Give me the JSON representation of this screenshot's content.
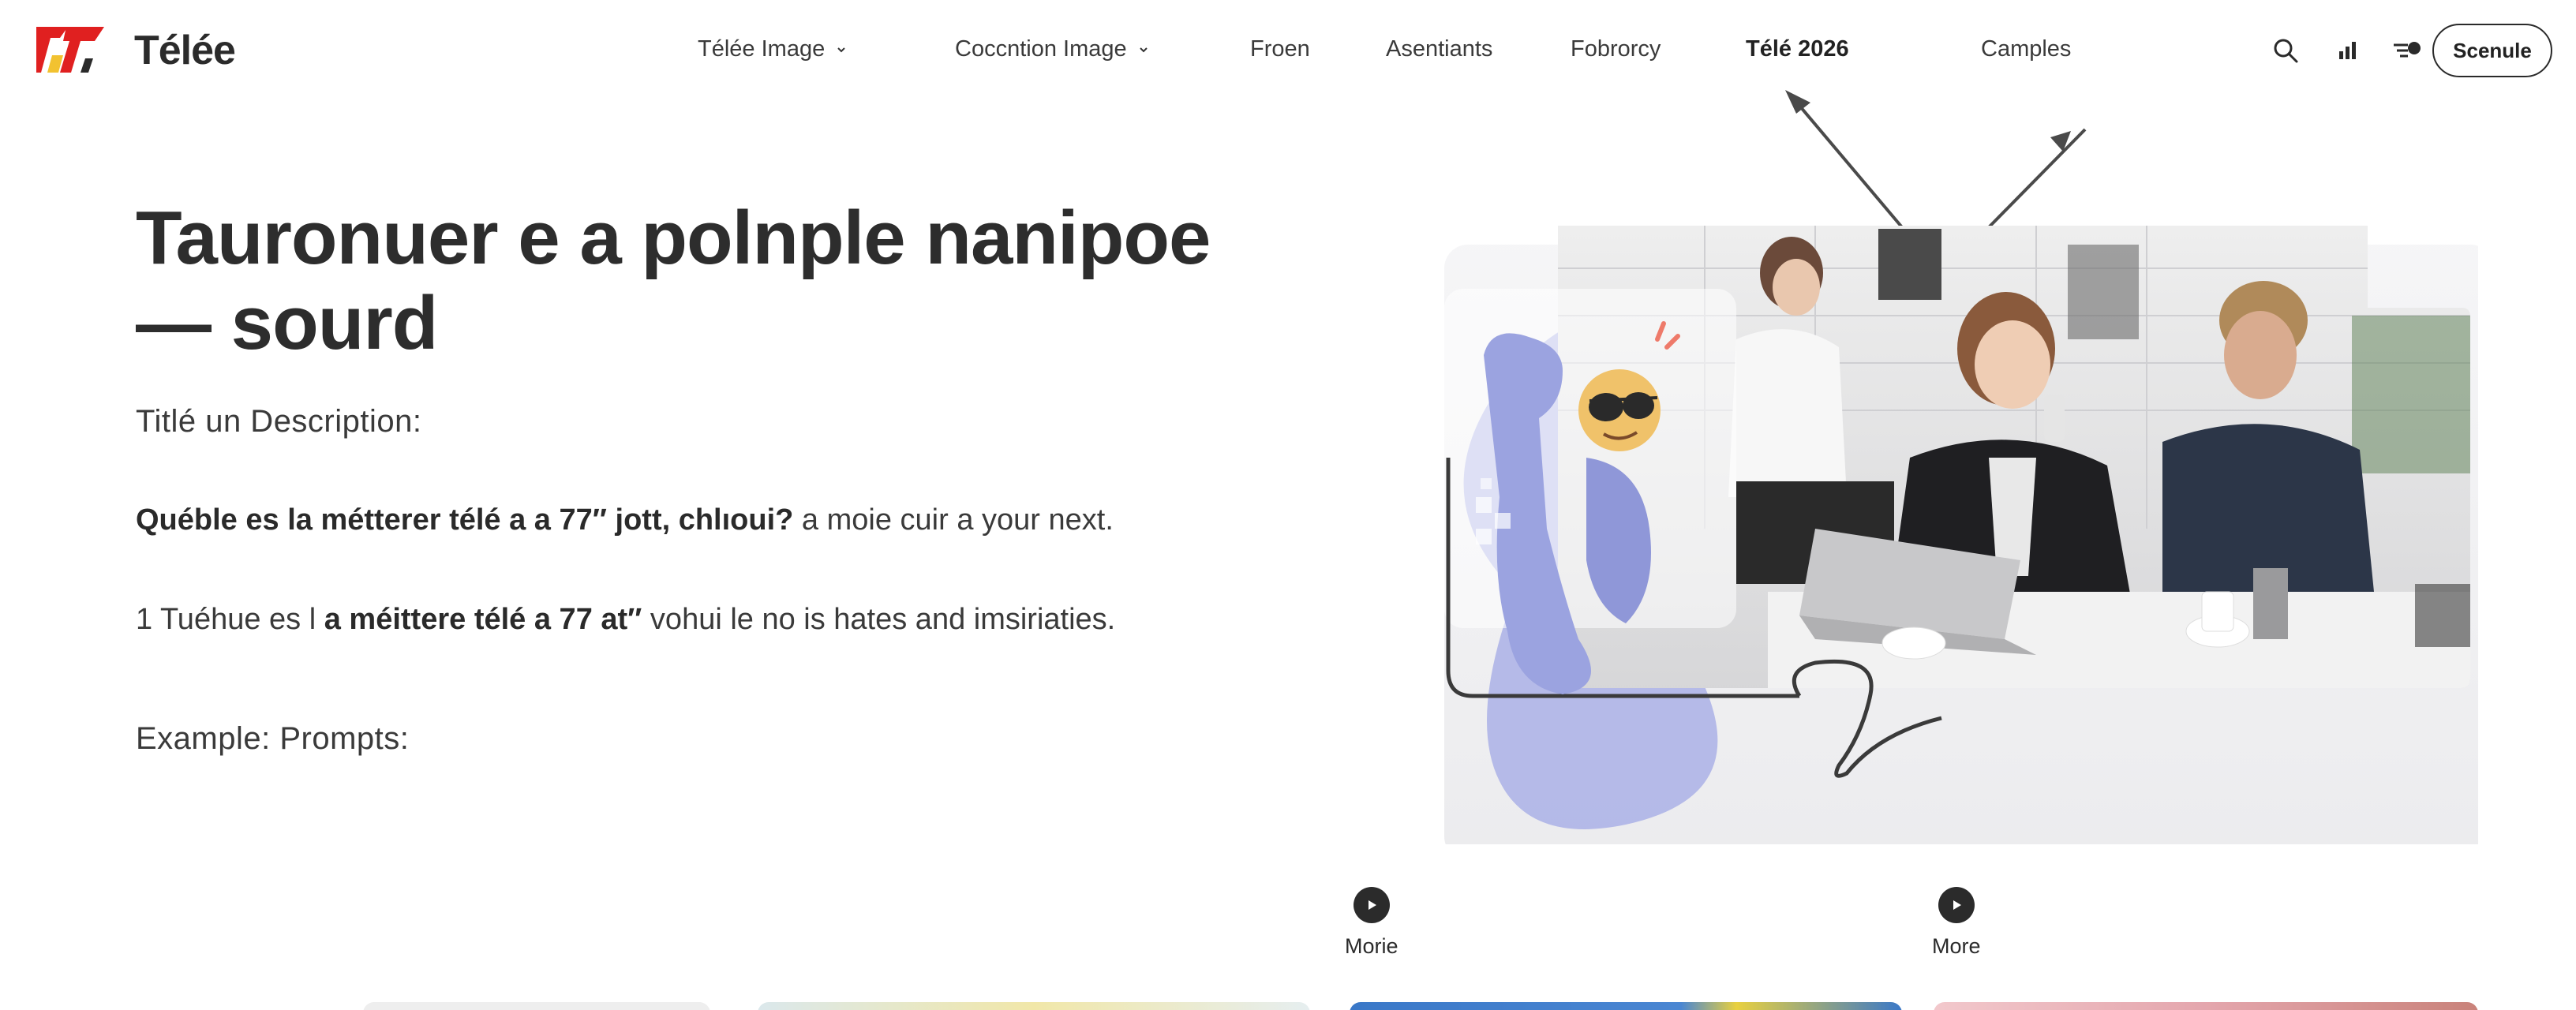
{
  "header": {
    "logo_mark": "77",
    "brand": "Télée",
    "nav": [
      {
        "label": "Télée Image",
        "has_dropdown": true
      },
      {
        "label": "Cocсntion Image",
        "has_dropdown": true
      },
      {
        "label": "Froen"
      },
      {
        "label": "Asentiants"
      },
      {
        "label": "Fobrorcy"
      },
      {
        "label": "Télé 2026",
        "active": true
      },
      {
        "label": "Camples"
      }
    ],
    "icons": [
      "search-icon",
      "signal-bars-icon",
      "chat-filter-icon"
    ],
    "schedule_label": "Scenule"
  },
  "hero": {
    "title": "Tauronuer e a polnple nanipoe — sourd",
    "subtitle": "Titlé un Description:",
    "para1_bold": "Québle es la métterer télé a a 77″ jott, chlıoui?",
    "para1_rest": " a moie cuir a your next.",
    "para2_a": "1 Tuéhue es l ",
    "para2_bold": "a méittere télé a 77 at″",
    "para2_rest": " vohui le no is hates and imsiriaties.",
    "examples_label": "Example: Prompts:"
  },
  "media": {
    "play_left_label": "Morie",
    "play_right_label": "More"
  },
  "colors": {
    "logo_red": "#e02020",
    "logo_yellow": "#f2c230",
    "mascot_lavender": "#aab0e6",
    "text_dark": "#2a2a2a",
    "card_blue": "#3a78c8",
    "card_pink": "#e4a6ad"
  }
}
